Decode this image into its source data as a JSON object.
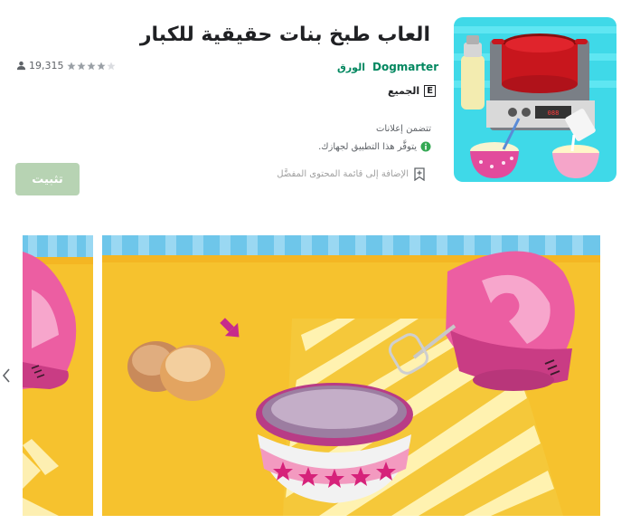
{
  "app": {
    "title": "العاب طبخ بنات حقيقية للكبار",
    "developer": "Dogmarter",
    "category": "الورق",
    "content_rating_badge": "E",
    "content_rating_label": "الجميع",
    "rating_count": "19,315",
    "stars_filled": 0,
    "stars_total": 5,
    "ads_note": "تتضمن إعلانات",
    "availability": "يتوفَّر هذا التطبيق لجهازك.",
    "wishlist_label": "الإضافة إلى قائمة المحتوى المفضَّل",
    "install_label": "تثبيت",
    "icon_name": "cooking-pot-app-icon"
  },
  "colors": {
    "developer_green": "#01875f",
    "install_button": "#b7d3b3",
    "muted_text": "#5f6368",
    "star_gray": "#9aa0a6"
  },
  "gallery": {
    "prev_icon": "chevron-left-icon",
    "screenshots": [
      "mixer-and-eggs-screenshot-partial",
      "mixer-eggs-bowl-screenshot"
    ]
  }
}
